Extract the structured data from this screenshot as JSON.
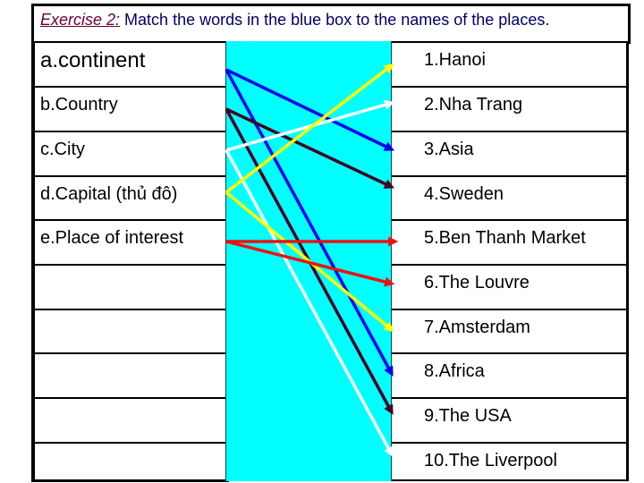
{
  "header": {
    "exercise_label": "Exercise 2:",
    "instruction": " Match the words in the blue box to the names of the places."
  },
  "colors": {
    "exercise_label": "#660033",
    "instruction": "#000066",
    "matching_box": "#00ffff"
  },
  "left_items": [
    "a.continent",
    "b.Country",
    "c.City",
    "d.Capital (thủ đô)",
    "e.Place of interest",
    "",
    "",
    "",
    "",
    ""
  ],
  "right_items": [
    "1.Hanoi",
    "2.Nha Trang",
    "3.Asia",
    "4.Sweden",
    "5.Ben Thanh Market",
    "6.The Louvre",
    "7.Amsterdam",
    "8.Africa",
    "9.The USA",
    "10.The Liverpool"
  ],
  "matches": [
    {
      "from": 0,
      "to": 2,
      "color": "#0000ee"
    },
    {
      "from": 0,
      "to": 7,
      "color": "#0000ee"
    },
    {
      "from": 1,
      "to": 3,
      "color": "#440022"
    },
    {
      "from": 1,
      "to": 8,
      "color": "#440022"
    },
    {
      "from": 2,
      "to": 1,
      "color": "#ffffff"
    },
    {
      "from": 2,
      "to": 9,
      "color": "#ffffff"
    },
    {
      "from": 3,
      "to": 0,
      "color": "#ffff00"
    },
    {
      "from": 3,
      "to": 6,
      "color": "#ffff00"
    },
    {
      "from": 4,
      "to": 4,
      "color": "#ee1111"
    },
    {
      "from": 4,
      "to": 5,
      "color": "#ee1111"
    }
  ]
}
